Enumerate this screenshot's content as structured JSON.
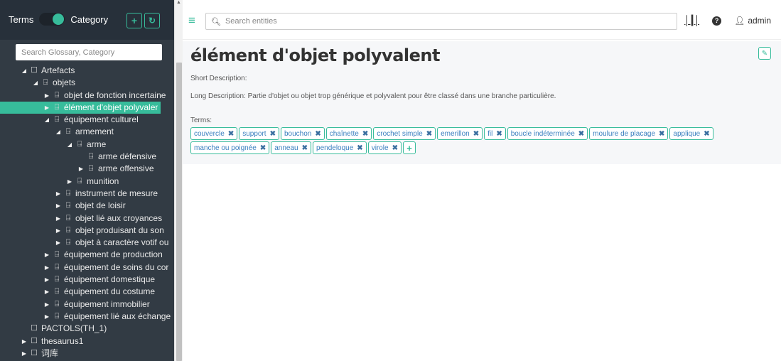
{
  "sidebar": {
    "toggle_left": "Terms",
    "toggle_right": "Category",
    "add_icon": "plus-icon",
    "refresh_icon": "refresh-icon",
    "search_placeholder": "Search Glossary, Category",
    "tree": [
      {
        "label": "Artefacts",
        "level": 0,
        "caret": "down",
        "icon": "folder"
      },
      {
        "label": "objets",
        "level": 1,
        "caret": "down",
        "icon": "tag"
      },
      {
        "label": "objet de fonction incertaine",
        "level": 2,
        "caret": "right",
        "icon": "tag"
      },
      {
        "label": "élément d'objet polyvalent",
        "level": 2,
        "caret": "right",
        "icon": "tag",
        "selected": true
      },
      {
        "label": "équipement culturel",
        "level": 2,
        "caret": "down",
        "icon": "tag"
      },
      {
        "label": "armement",
        "level": 3,
        "caret": "down",
        "icon": "tag"
      },
      {
        "label": "arme",
        "level": 4,
        "caret": "down",
        "icon": "tag"
      },
      {
        "label": "arme défensive",
        "level": 5,
        "caret": "none",
        "icon": "tag"
      },
      {
        "label": "arme offensive",
        "level": 5,
        "caret": "right",
        "icon": "tag"
      },
      {
        "label": "munition",
        "level": 4,
        "caret": "right",
        "icon": "tag"
      },
      {
        "label": "instrument de mesure",
        "level": 3,
        "caret": "right",
        "icon": "tag"
      },
      {
        "label": "objet de loisir",
        "level": 3,
        "caret": "right",
        "icon": "tag"
      },
      {
        "label": "objet lié aux croyances",
        "level": 3,
        "caret": "right",
        "icon": "tag"
      },
      {
        "label": "objet produisant du son",
        "level": 3,
        "caret": "right",
        "icon": "tag"
      },
      {
        "label": "objet à caractère votif ou",
        "level": 3,
        "caret": "right",
        "icon": "tag"
      },
      {
        "label": "équipement de production",
        "level": 2,
        "caret": "right",
        "icon": "tag"
      },
      {
        "label": "équipement de soins du cor",
        "level": 2,
        "caret": "right",
        "icon": "tag"
      },
      {
        "label": "équipement domestique",
        "level": 2,
        "caret": "right",
        "icon": "tag"
      },
      {
        "label": "équipement du costume",
        "level": 2,
        "caret": "right",
        "icon": "tag"
      },
      {
        "label": "équipement immobilier",
        "level": 2,
        "caret": "right",
        "icon": "tag"
      },
      {
        "label": "équipement lié aux échange",
        "level": 2,
        "caret": "right",
        "icon": "tag"
      },
      {
        "label": "PACTOLS(TH_1)",
        "level": 0,
        "caret": "none",
        "icon": "folder"
      },
      {
        "label": "thesaurus1",
        "level": 0,
        "caret": "right",
        "icon": "folder"
      },
      {
        "label": "词库",
        "level": 0,
        "caret": "right",
        "icon": "folder"
      }
    ]
  },
  "topbar": {
    "menu_icon": "hamburger-icon",
    "search_placeholder": "Search entities",
    "stats_icon": "bar-chart-icon",
    "help_icon": "question-circle-icon",
    "user_icon": "user-icon",
    "user_name": "admin"
  },
  "detail": {
    "title": "élément d'objet polyvalent",
    "edit_icon": "pencil-icon",
    "short_description_label": "Short Description:",
    "long_description_label": "Long Description:",
    "long_description": "Partie d'objet ou objet trop générique et polyvalent pour être classé dans une branche particulière.",
    "terms_label": "Terms:",
    "terms_row1": [
      "couvercle",
      "support",
      "bouchon",
      "chaînette",
      "crochet simple",
      "emerillon",
      "fil",
      "boucle indéterminée",
      "moulure de placage",
      "applique"
    ],
    "terms_row2": [
      "manche ou poignée",
      "anneau",
      "pendeloque",
      "virole"
    ],
    "add_term_icon": "plus-icon"
  },
  "colors": {
    "accent": "#37bc9b",
    "sidebar_bg": "#323b44",
    "sidebar_header_bg": "#27303a",
    "chip_text": "#3a7fbf",
    "content_bg": "#f6f7f9"
  }
}
